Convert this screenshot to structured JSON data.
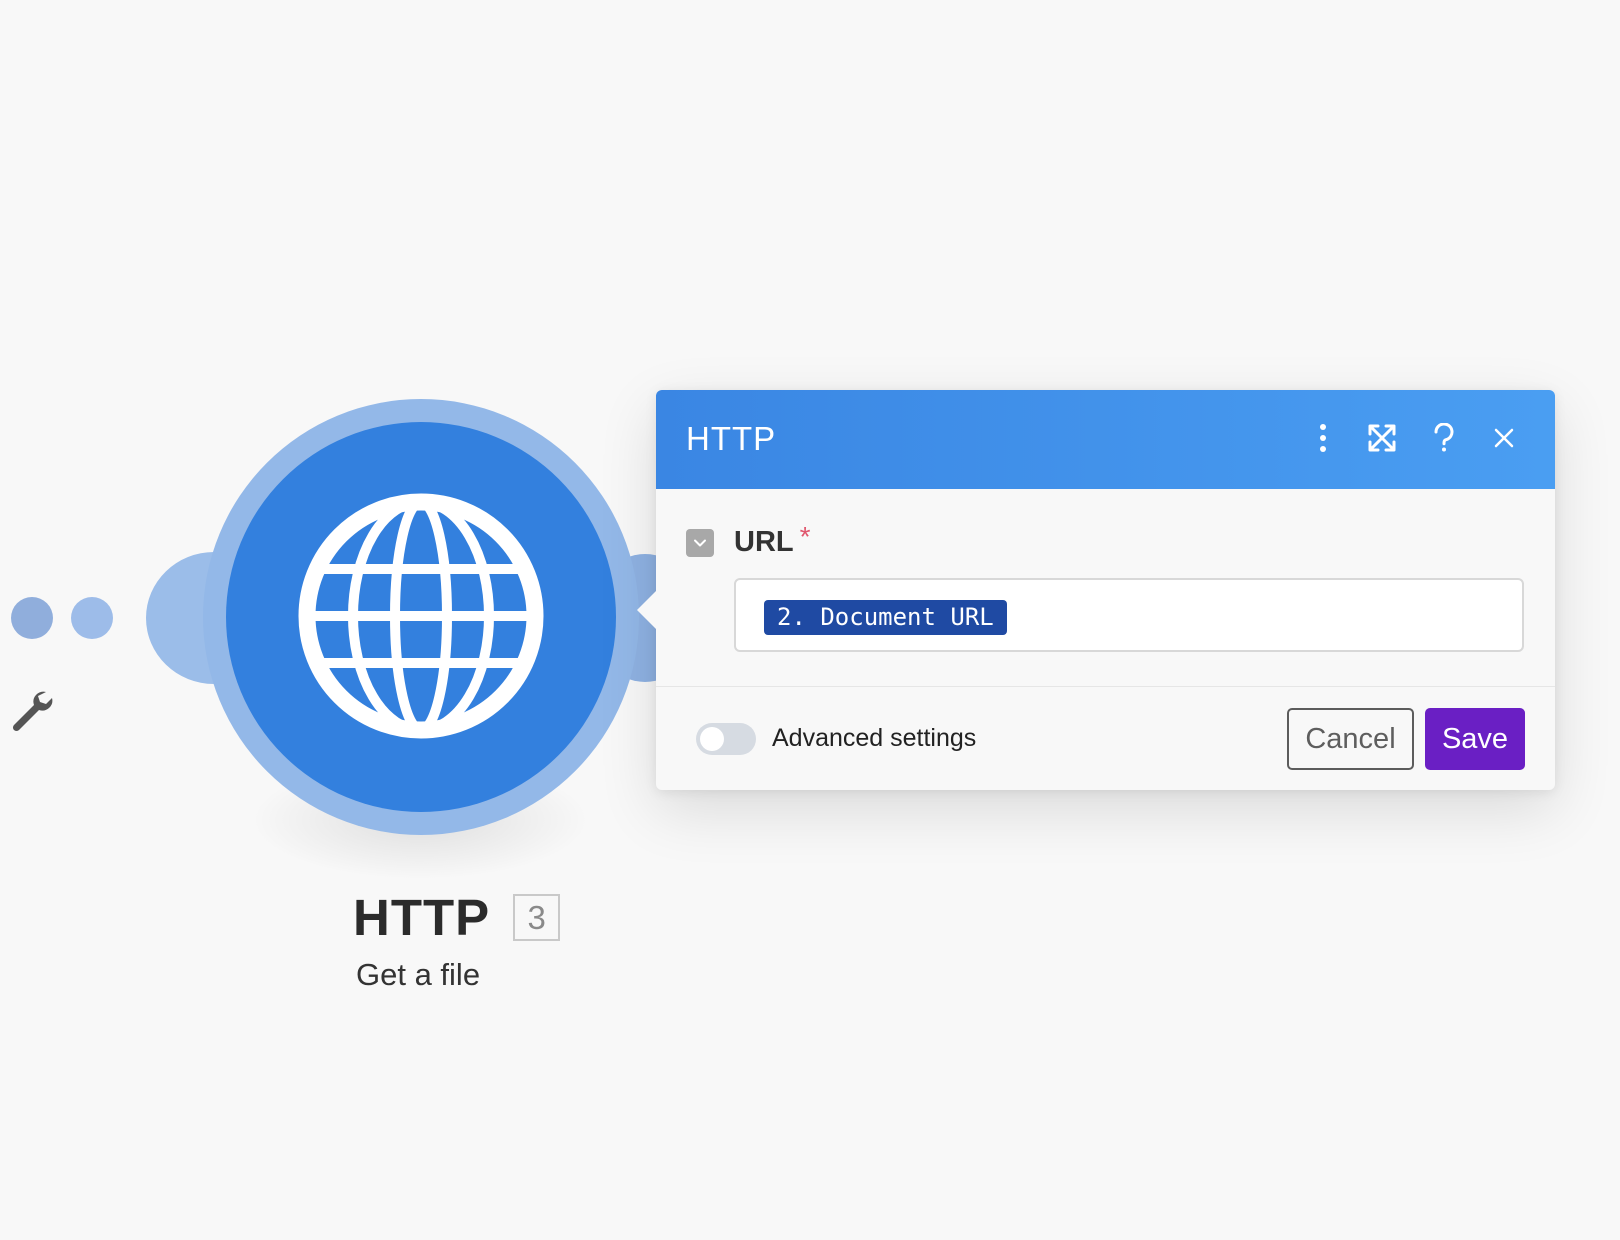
{
  "module": {
    "title": "HTTP",
    "number": "3",
    "subtitle": "Get a file",
    "icon": "globe-icon",
    "color": "#3380de"
  },
  "canvas": {
    "connector_icons": [
      "dot-icon",
      "dot-icon",
      "wrench-icon"
    ]
  },
  "dialog": {
    "title": "HTTP",
    "header_actions": [
      "more-vertical-icon",
      "expand-icon",
      "help-icon",
      "close-icon"
    ],
    "field": {
      "label": "URL",
      "required_mark": "*",
      "value_token": "2. Document URL"
    },
    "advanced_settings_label": "Advanced settings",
    "advanced_settings_enabled": false,
    "cancel_label": "Cancel",
    "save_label": "Save",
    "colors": {
      "header": "#3a86e3",
      "save": "#6a1fc4",
      "token": "#1f4aa3",
      "required": "#e0566d"
    }
  }
}
